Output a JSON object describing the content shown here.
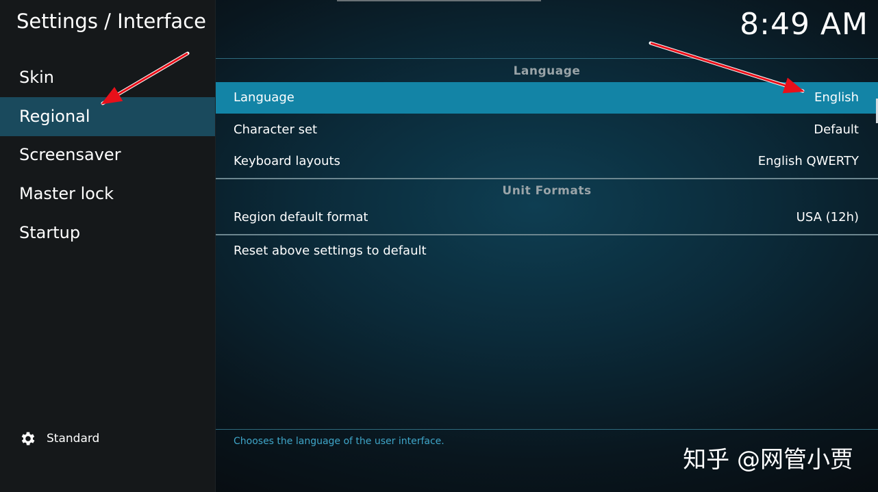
{
  "window": {
    "title": "Settings / Interface"
  },
  "clock": {
    "time": "8:49 AM"
  },
  "sidebar": {
    "items": [
      {
        "label": "Skin",
        "active": false
      },
      {
        "label": "Regional",
        "active": true
      },
      {
        "label": "Screensaver",
        "active": false
      },
      {
        "label": "Master lock",
        "active": false
      },
      {
        "label": "Startup",
        "active": false
      }
    ],
    "settings_level": {
      "icon": "gear-icon",
      "label": "Standard"
    }
  },
  "content": {
    "groups": [
      {
        "header": "Language",
        "rows": [
          {
            "label": "Language",
            "value": "English",
            "focused": true
          },
          {
            "label": "Character set",
            "value": "Default",
            "focused": false
          },
          {
            "label": "Keyboard layouts",
            "value": "English QWERTY",
            "focused": false
          }
        ]
      },
      {
        "header": "Unit Formats",
        "rows": [
          {
            "label": "Region default format",
            "value": "USA (12h)",
            "focused": false
          }
        ]
      }
    ],
    "reset_label": "Reset above settings to default",
    "description": "Chooses the language of the user interface."
  },
  "watermark": "知乎 @网管小贾",
  "colors": {
    "focus_highlight": "#1384a6",
    "sidebar_active": "#1a4a5d",
    "description_text": "#3fa6c9",
    "annotation_arrow": "#e8101a"
  }
}
